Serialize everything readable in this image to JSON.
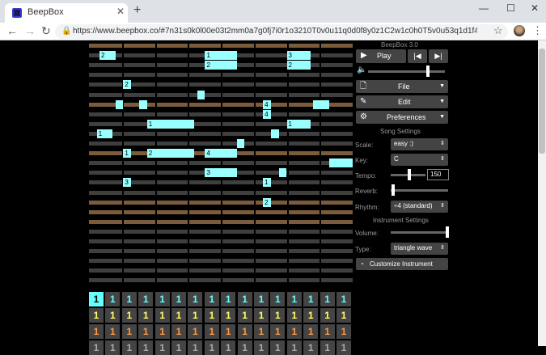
{
  "browser": {
    "tab_title": "BeepBox",
    "url": "https://www.beepbox.co/#7n31s0k0l00e03t2mm0a7g0fj7i0r1o3210T0v0u11q0d0f8y0z1C2w1c0h0T5v0u53q1d1f4y1z4C1c0h0H_..."
  },
  "app": {
    "title": "BeepBox 3.0",
    "play_label": "Play",
    "file_label": "File",
    "edit_label": "Edit",
    "preferences_label": "Preferences",
    "song_settings_label": "Song Settings",
    "scale_label": "Scale:",
    "scale_value": "easy :)",
    "key_label": "Key:",
    "key_value": "C",
    "tempo_label": "Tempo:",
    "tempo_value": "150",
    "reverb_label": "Reverb:",
    "rhythm_label": "Rhythm:",
    "rhythm_value": "÷4 (standard)",
    "instrument_settings_label": "Instrument Settings",
    "volume_label": "Volume:",
    "type_label": "Type:",
    "type_value": "triangle wave",
    "customize_label": "Customize Instrument",
    "pattern_numbers": [
      "1",
      "1",
      "1",
      "1",
      "1",
      "1",
      "1",
      "1",
      "1",
      "1",
      "1",
      "1",
      "1",
      "1",
      "1",
      "1"
    ]
  },
  "notes": [
    {
      "row": 1,
      "start": 0.04,
      "w": 0.06,
      "label": "2"
    },
    {
      "row": 1,
      "start": 0.44,
      "w": 0.12,
      "label": "1"
    },
    {
      "row": 1,
      "start": 0.75,
      "w": 0.09,
      "label": "3"
    },
    {
      "row": 2,
      "start": 0.44,
      "w": 0.12,
      "label": "2"
    },
    {
      "row": 2,
      "start": 0.75,
      "w": 0.09,
      "label": "2"
    },
    {
      "row": 4,
      "start": 0.13,
      "w": 0.03,
      "label": "2"
    },
    {
      "row": 5,
      "start": 0.41,
      "w": 0.03,
      "label": ""
    },
    {
      "row": 6,
      "start": 0.1,
      "w": 0.03,
      "label": ""
    },
    {
      "row": 6,
      "start": 0.19,
      "w": 0.03,
      "label": ""
    },
    {
      "row": 6,
      "start": 0.66,
      "w": 0.03,
      "label": "4"
    },
    {
      "row": 6,
      "start": 0.85,
      "w": 0.03,
      "label": ""
    },
    {
      "row": 6,
      "start": 0.88,
      "w": 0.03,
      "label": ""
    },
    {
      "row": 7,
      "start": 0.66,
      "w": 0.03,
      "label": "4"
    },
    {
      "row": 8,
      "start": 0.22,
      "w": 0.18,
      "label": "1"
    },
    {
      "row": 8,
      "start": 0.75,
      "w": 0.09,
      "label": "1"
    },
    {
      "row": 9,
      "start": 0.03,
      "w": 0.06,
      "label": "1"
    },
    {
      "row": 9,
      "start": 0.69,
      "w": 0.03,
      "label": ""
    },
    {
      "row": 10,
      "start": 0.56,
      "w": 0.03,
      "label": ""
    },
    {
      "row": 11,
      "start": 0.13,
      "w": 0.03,
      "label": "1"
    },
    {
      "row": 11,
      "start": 0.22,
      "w": 0.18,
      "label": "2"
    },
    {
      "row": 11,
      "start": 0.44,
      "w": 0.12,
      "label": "4"
    },
    {
      "row": 12,
      "start": 0.91,
      "w": 0.09,
      "label": ""
    },
    {
      "row": 13,
      "start": 0.44,
      "w": 0.12,
      "label": "3"
    },
    {
      "row": 13,
      "start": 0.72,
      "w": 0.03,
      "label": ""
    },
    {
      "row": 14,
      "start": 0.13,
      "w": 0.03,
      "label": "3"
    },
    {
      "row": 14,
      "start": 0.66,
      "w": 0.03,
      "label": "1"
    },
    {
      "row": 16,
      "start": 0.66,
      "w": 0.03,
      "label": "2"
    }
  ],
  "colors": {
    "row_gray": "#3f3f3f",
    "row_brown": "#7a5c3c",
    "note": "#99ffff",
    "pattern_cyan": "#66ffff",
    "pattern_yellow": "#ffff66",
    "pattern_orange": "#ff9944"
  }
}
